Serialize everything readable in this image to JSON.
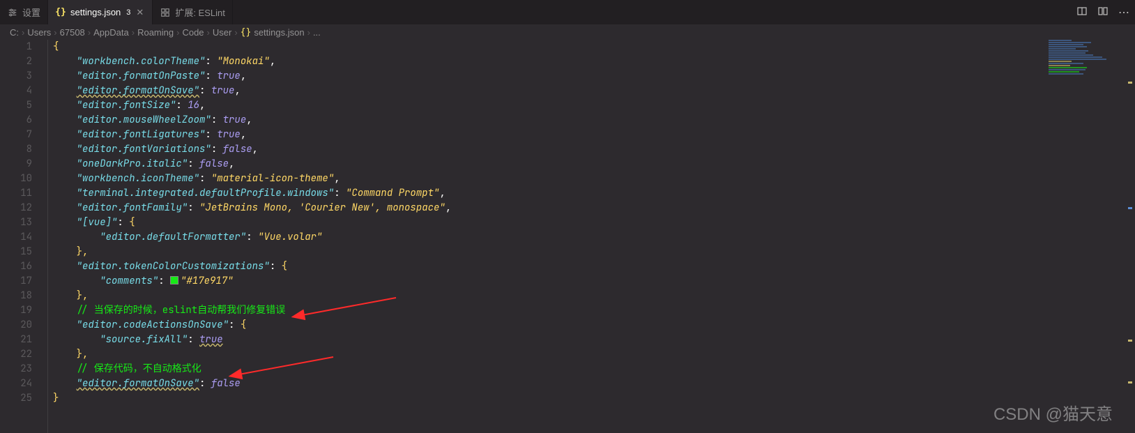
{
  "tabs": {
    "t0": {
      "label": "设置"
    },
    "t1": {
      "label": "settings.json",
      "dirty": "3"
    },
    "t2": {
      "label": "扩展: ESLint"
    }
  },
  "actions": {
    "compare": "⮂",
    "split": "▥",
    "more": "⋯"
  },
  "breadcrumbs": {
    "p0": "C:",
    "p1": "Users",
    "p2": "67508",
    "p3": "AppData",
    "p4": "Roaming",
    "p5": "Code",
    "p6": "User",
    "p7": "settings.json",
    "p8": "..."
  },
  "code": {
    "l1": {
      "b": "{"
    },
    "l2": {
      "k": "\"workbench.colorTheme\"",
      "v": "\"Monokai\""
    },
    "l3": {
      "k": "\"editor.formatOnPaste\"",
      "v": "true"
    },
    "l4": {
      "k": "\"editor.formatOnSave\"",
      "v": "true"
    },
    "l5": {
      "k": "\"editor.fontSize\"",
      "v": "16"
    },
    "l6": {
      "k": "\"editor.mouseWheelZoom\"",
      "v": "true"
    },
    "l7": {
      "k": "\"editor.fontLigatures\"",
      "v": "true"
    },
    "l8": {
      "k": "\"editor.fontVariations\"",
      "v": "false"
    },
    "l9": {
      "k": "\"oneDarkPro.italic\"",
      "v": "false"
    },
    "l10": {
      "k": "\"workbench.iconTheme\"",
      "v": "\"material-icon-theme\""
    },
    "l11": {
      "k": "\"terminal.integrated.defaultProfile.windows\"",
      "v": "\"Command Prompt\""
    },
    "l12": {
      "k": "\"editor.fontFamily\"",
      "v": "\"JetBrains Mono, 'Courier New', monospace\""
    },
    "l13": {
      "k": "\"[vue]\"",
      "b": "{"
    },
    "l14": {
      "k": "\"editor.defaultFormatter\"",
      "v": "\"Vue.volar\""
    },
    "l15": {
      "b": "},"
    },
    "l16": {
      "k": "\"editor.tokenColorCustomizations\"",
      "b": "{"
    },
    "l17": {
      "k": "\"comments\"",
      "v": "\"#17e917\""
    },
    "l18": {
      "b": "},"
    },
    "l19": {
      "c": "// 当保存的时候，eslint自动帮我们修复错误"
    },
    "l20": {
      "k": "\"editor.codeActionsOnSave\"",
      "b": "{"
    },
    "l21": {
      "k": "\"source.fixAll\"",
      "v": "true"
    },
    "l22": {
      "b": "},"
    },
    "l23": {
      "c": "// 保存代码，不自动格式化"
    },
    "l24": {
      "k": "\"editor.formatOnSave\"",
      "v": "false"
    },
    "l25": {
      "b": "}"
    }
  },
  "watermark": "CSDN @猫天意"
}
